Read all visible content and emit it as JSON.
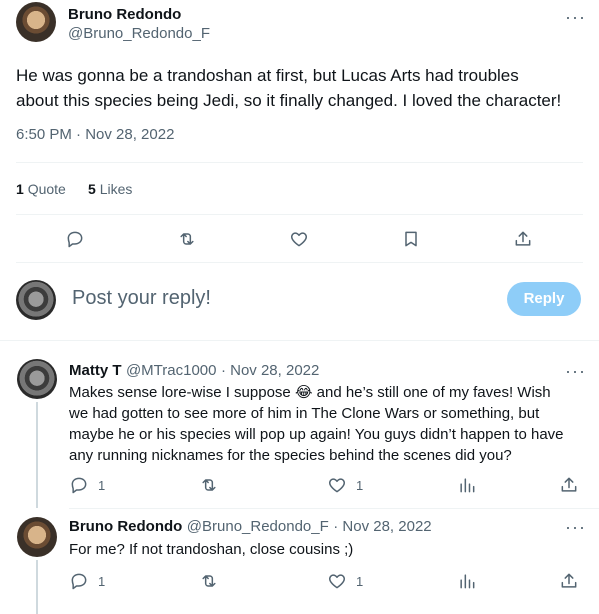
{
  "main_tweet": {
    "name": "Bruno Redondo",
    "handle": "@Bruno_Redondo_F",
    "text_line1": "He was gonna be a trandoshan at first, but Lucas Arts had troubles",
    "text_line2": "about this species being Jedi, so it finally changed. I loved the character!",
    "timestamp": "6:50 PM · Nov 28, 2022",
    "stats": {
      "quotes_count": "1",
      "quotes_label": "Quote",
      "likes_count": "5",
      "likes_label": "Likes"
    },
    "more": "···"
  },
  "composer": {
    "placeholder": "Post your reply!",
    "reply_button": "Reply"
  },
  "replies": [
    {
      "name": "Matty T",
      "handle": "@MTrac1000",
      "date": "· Nov 28, 2022",
      "text_line1": "Makes sense lore-wise I suppose 😂 and he’s still one of my faves! Wish",
      "text_line2": "we had gotten to see more of him in The Clone Wars or something, but",
      "text_line3": "maybe he or his species will pop up again! You guys didn’t happen to have",
      "text_line4": "any running nicknames for the species behind the scenes did you?",
      "reply_count": "1",
      "like_count": "1",
      "more": "···"
    },
    {
      "name": "Bruno Redondo",
      "handle": "@Bruno_Redondo_F",
      "date": "· Nov 28, 2022",
      "text_line1": "For me? If not trandoshan, close cousins ;)",
      "reply_count": "1",
      "like_count": "1",
      "more": "···"
    }
  ],
  "colors": {
    "accent_disabled": "#8ecdf8",
    "text_primary": "#0f1419",
    "text_muted": "#536471",
    "divider": "#eff3f4"
  }
}
